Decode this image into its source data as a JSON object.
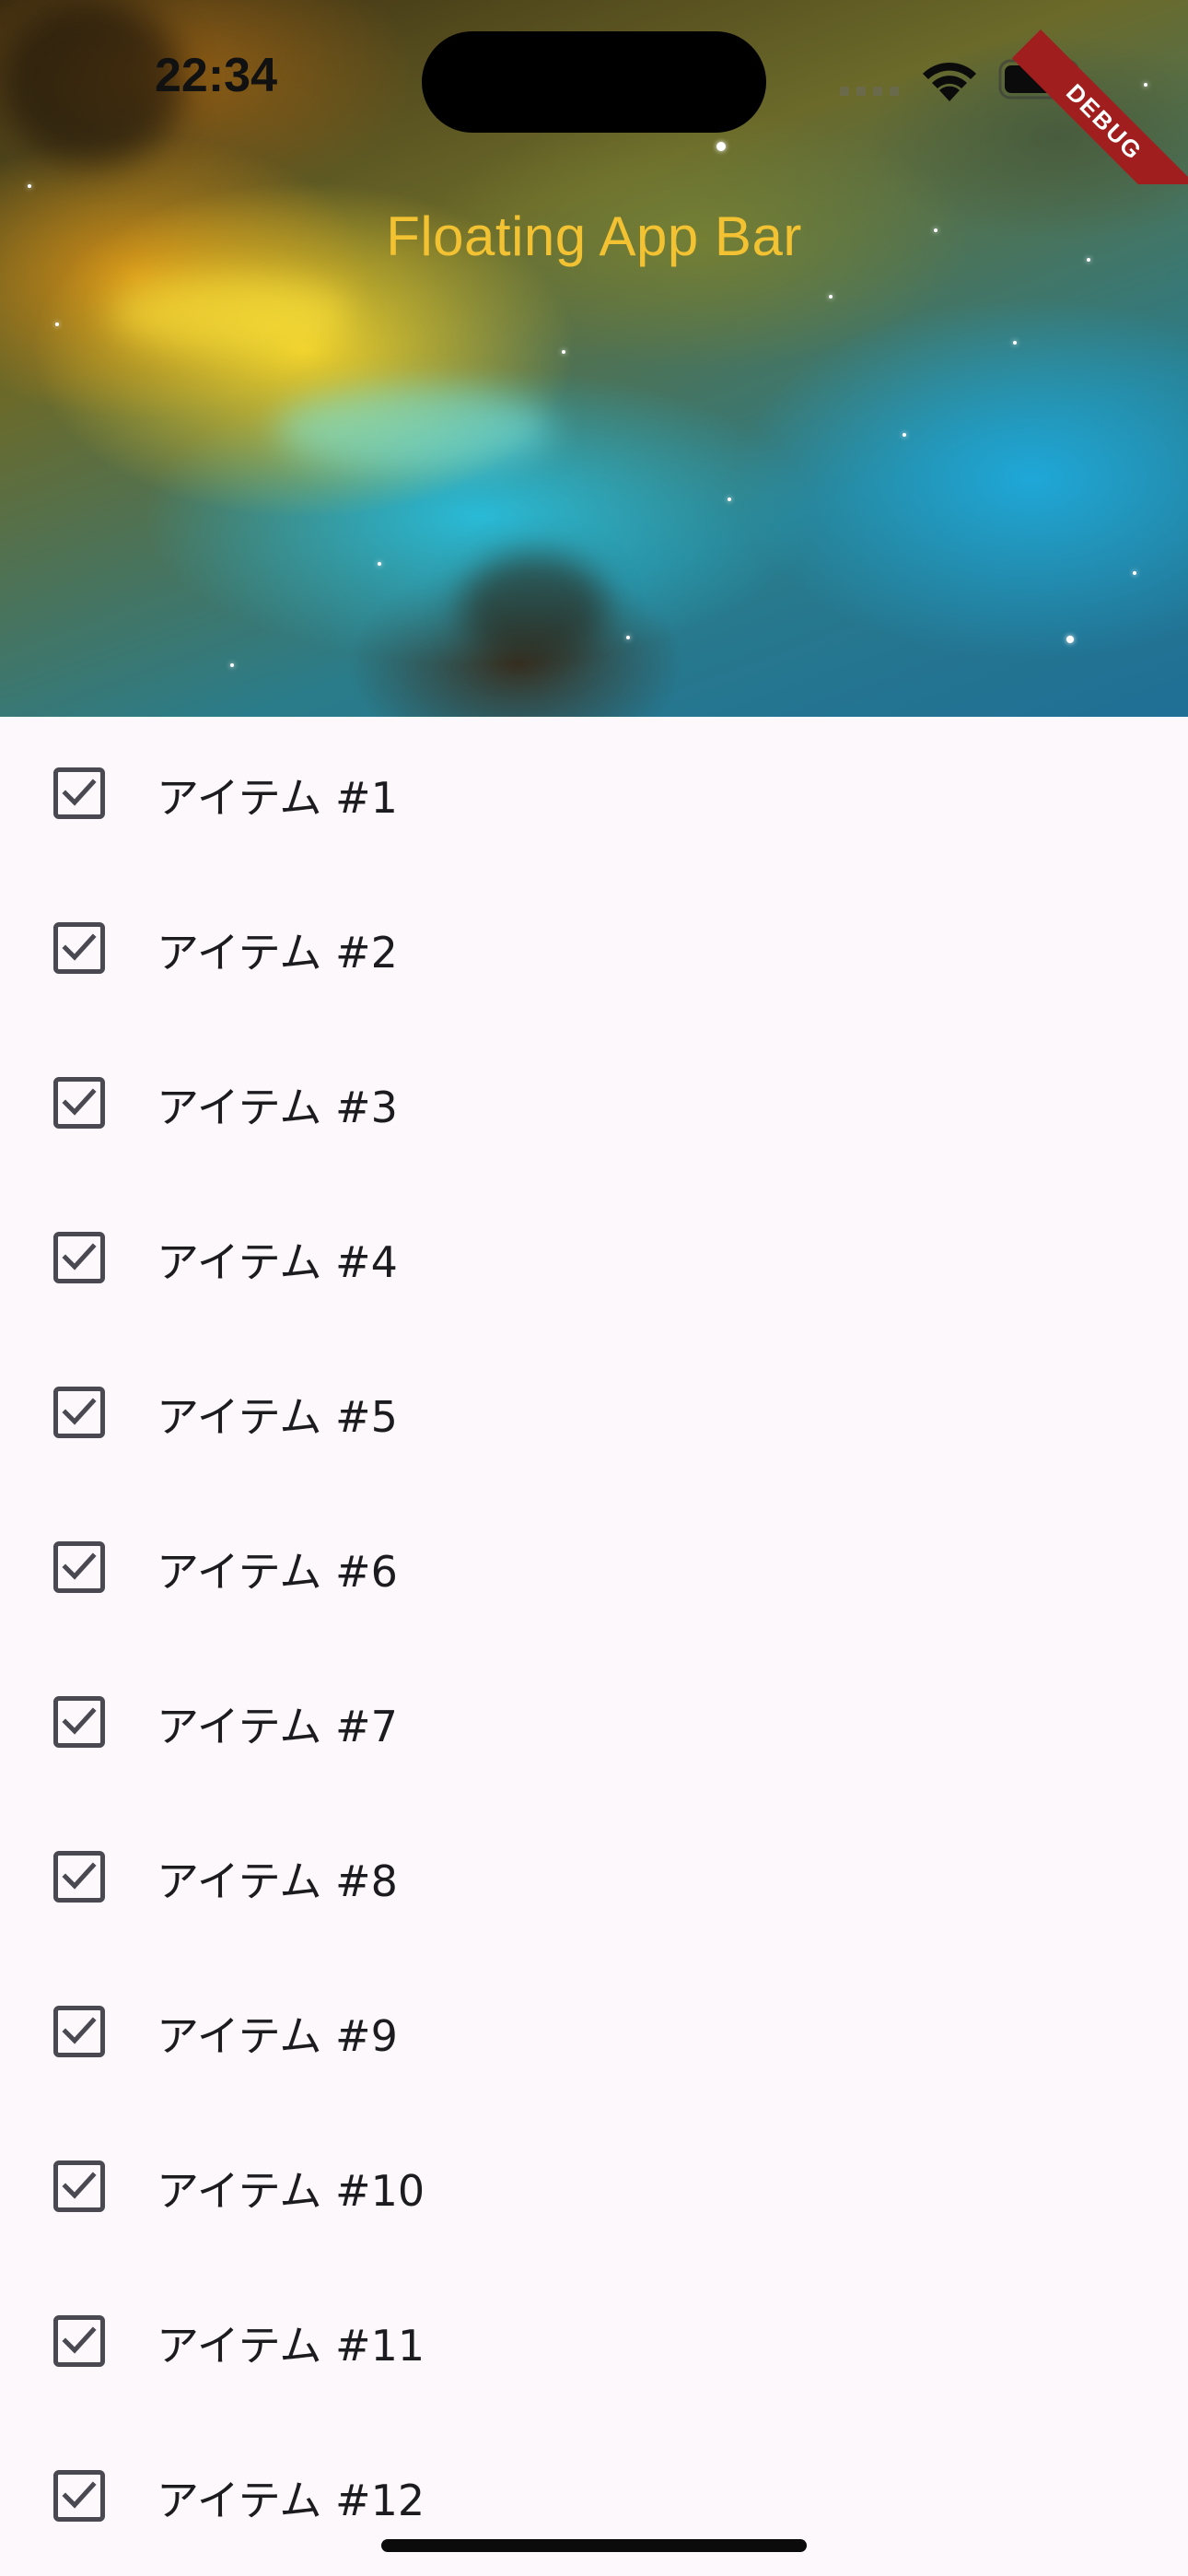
{
  "status_bar": {
    "time": "22:34"
  },
  "debug_banner": "DEBUG",
  "app_bar": {
    "title": "Floating App Bar",
    "title_color": "#f2c232"
  },
  "items": [
    {
      "label": "アイテム #1",
      "checked": true
    },
    {
      "label": "アイテム #2",
      "checked": true
    },
    {
      "label": "アイテム #3",
      "checked": true
    },
    {
      "label": "アイテム #4",
      "checked": true
    },
    {
      "label": "アイテム #5",
      "checked": true
    },
    {
      "label": "アイテム #6",
      "checked": true
    },
    {
      "label": "アイテム #7",
      "checked": true
    },
    {
      "label": "アイテム #8",
      "checked": true
    },
    {
      "label": "アイテム #9",
      "checked": true
    },
    {
      "label": "アイテム #10",
      "checked": true
    },
    {
      "label": "アイテム #11",
      "checked": true
    },
    {
      "label": "アイテム #12",
      "checked": true
    }
  ],
  "icons": {
    "checkbox": "check-box-icon",
    "wifi": "wifi-icon",
    "battery": "battery-icon",
    "signal": "cellular-signal-icon"
  },
  "colors": {
    "background": "#fdf8fc",
    "checkbox_border": "#4a4850",
    "text": "#1c1b1f",
    "debug_ribbon": "#a01e1e"
  }
}
